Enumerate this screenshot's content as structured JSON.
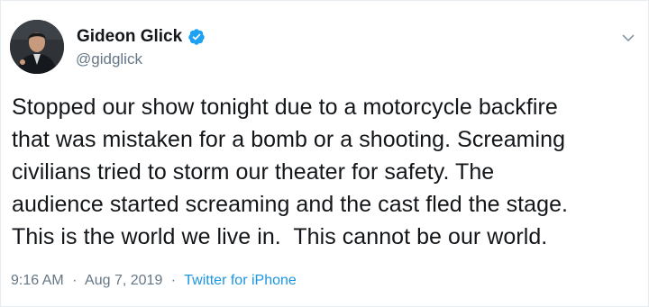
{
  "tweet": {
    "author": {
      "display_name": "Gideon Glick",
      "handle": "@gidglick",
      "verified_icon": "verified-badge-icon",
      "avatar_icon": "profile-photo"
    },
    "more_icon": "chevron-down-icon",
    "text": "Stopped our show tonight due to a motorcycle backfire\nthat was mistaken for a bomb or a shooting. Screaming\ncivilians tried to storm our theater for safety. The\naudience started screaming and the cast fled the stage.\nThis is the world we live in.  This cannot be our world.",
    "time": "9:16 AM",
    "separator": "·",
    "date": "Aug 7, 2019",
    "source": "Twitter for iPhone"
  },
  "colors": {
    "text": "#14171a",
    "secondary": "#657786",
    "link": "#1b95e0",
    "verified": "#1da1f2",
    "border": "#e6ecf0"
  }
}
